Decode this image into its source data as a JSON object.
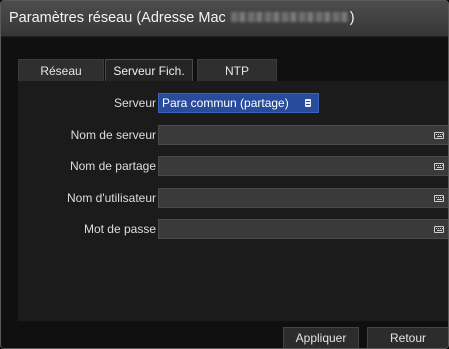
{
  "window": {
    "title_prefix": "Paramètres réseau (Adresse Mac",
    "title_suffix": ")"
  },
  "tabs": [
    {
      "label": "Réseau",
      "selected": false
    },
    {
      "label": "Serveur Fich.",
      "selected": true
    },
    {
      "label": "NTP",
      "selected": false
    }
  ],
  "form": {
    "server": {
      "label": "Serveur",
      "value": "Para commun (partage)",
      "icon": "list-icon"
    },
    "fields": [
      {
        "label": "Nom de serveur",
        "value": "",
        "icon": "keyboard-icon"
      },
      {
        "label": "Nom de partage",
        "value": "",
        "icon": "keyboard-icon"
      },
      {
        "label": "Nom d'utilisateur",
        "value": "",
        "icon": "keyboard-icon"
      },
      {
        "label": "Mot de passe",
        "value": "",
        "icon": "keyboard-icon"
      }
    ]
  },
  "buttons": {
    "apply": "Appliquer",
    "back": "Retour"
  },
  "colors": {
    "selected_value_bg": "#284b9c",
    "title_bar": "#3e3e3e",
    "field_bg": "#3a3a3a"
  }
}
